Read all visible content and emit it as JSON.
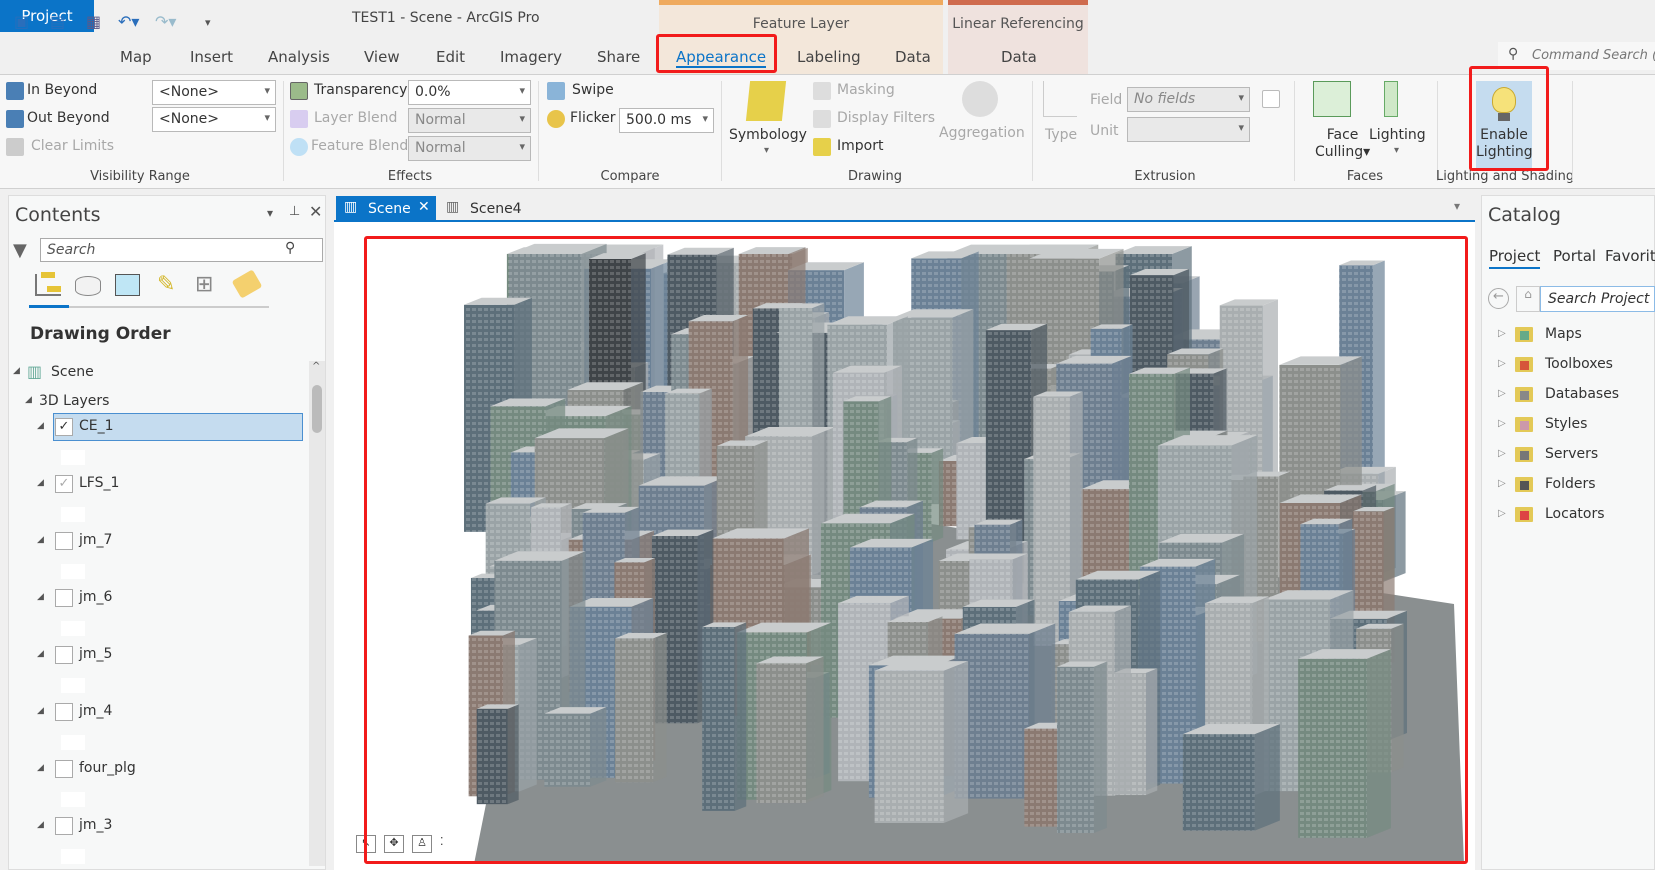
{
  "window": {
    "title": "TEST1 - Scene - ArcGIS Pro"
  },
  "qat": {
    "icons": [
      "new-project-icon",
      "open-project-icon",
      "save-icon",
      "undo-icon",
      "redo-icon",
      "customize-icon"
    ]
  },
  "context_tabs": {
    "feature_layer": "Feature Layer",
    "linear_referencing": "Linear Referencing"
  },
  "tabs": [
    "Project",
    "Map",
    "Insert",
    "Analysis",
    "View",
    "Edit",
    "Imagery",
    "Share",
    "Appearance",
    "Labeling",
    "Data",
    "Data"
  ],
  "active_tab": "Appearance",
  "command_search": {
    "placeholder": "Command Search ("
  },
  "ribbon": {
    "visibility": {
      "in_beyond": "In Beyond",
      "out_beyond": "Out Beyond",
      "clear_limits": "Clear Limits",
      "in_value": "<None>",
      "out_value": "<None>",
      "group": "Visibility Range"
    },
    "effects": {
      "transparency": "Transparency",
      "transparency_value": "0.0%",
      "layer_blend": "Layer Blend",
      "layer_blend_value": "Normal",
      "feature_blend": "Feature Blend",
      "feature_blend_value": "Normal",
      "group": "Effects"
    },
    "compare": {
      "swipe": "Swipe",
      "flicker": "Flicker",
      "flicker_value": "500.0  ms",
      "group": "Compare"
    },
    "drawing": {
      "symbology": "Symbology",
      "masking": "Masking",
      "display_filters": "Display Filters",
      "import": "Import",
      "aggregation": "Aggregation",
      "group": "Drawing"
    },
    "extrusion": {
      "type": "Type",
      "field": "Field",
      "field_value": "No fields",
      "unit": "Unit",
      "group": "Extrusion"
    },
    "faces": {
      "face": "Face",
      "culling": "Culling",
      "lighting": "Lighting",
      "group": "Faces"
    },
    "lighting_shading": {
      "enable": "Enable",
      "lighting": "Lighting",
      "group": "Lighting and Shading"
    }
  },
  "contents": {
    "title": "Contents",
    "search_placeholder": "Search",
    "section": "Drawing Order",
    "scene": "Scene",
    "layers_group": "3D Layers",
    "layers": [
      {
        "name": "CE_1",
        "checked": true,
        "selected": true
      },
      {
        "name": "LFS_1",
        "checked": true
      },
      {
        "name": "jm_7",
        "checked": false
      },
      {
        "name": "jm_6",
        "checked": false
      },
      {
        "name": "jm_5",
        "checked": false
      },
      {
        "name": "jm_4",
        "checked": false
      },
      {
        "name": "four_plg",
        "checked": false
      },
      {
        "name": "jm_3",
        "checked": false
      }
    ]
  },
  "view_tabs": [
    {
      "label": "Scene",
      "active": true
    },
    {
      "label": "Scene4",
      "active": false
    }
  ],
  "catalog": {
    "title": "Catalog",
    "tabs": [
      "Project",
      "Portal",
      "Favorites"
    ],
    "search_placeholder": "Search Project",
    "items": [
      "Maps",
      "Toolboxes",
      "Databases",
      "Styles",
      "Servers",
      "Folders",
      "Locators"
    ]
  },
  "colors": {
    "accent": "#0b74c8",
    "highlight": "#f21b1b",
    "selected_row": "#c5dcef"
  }
}
